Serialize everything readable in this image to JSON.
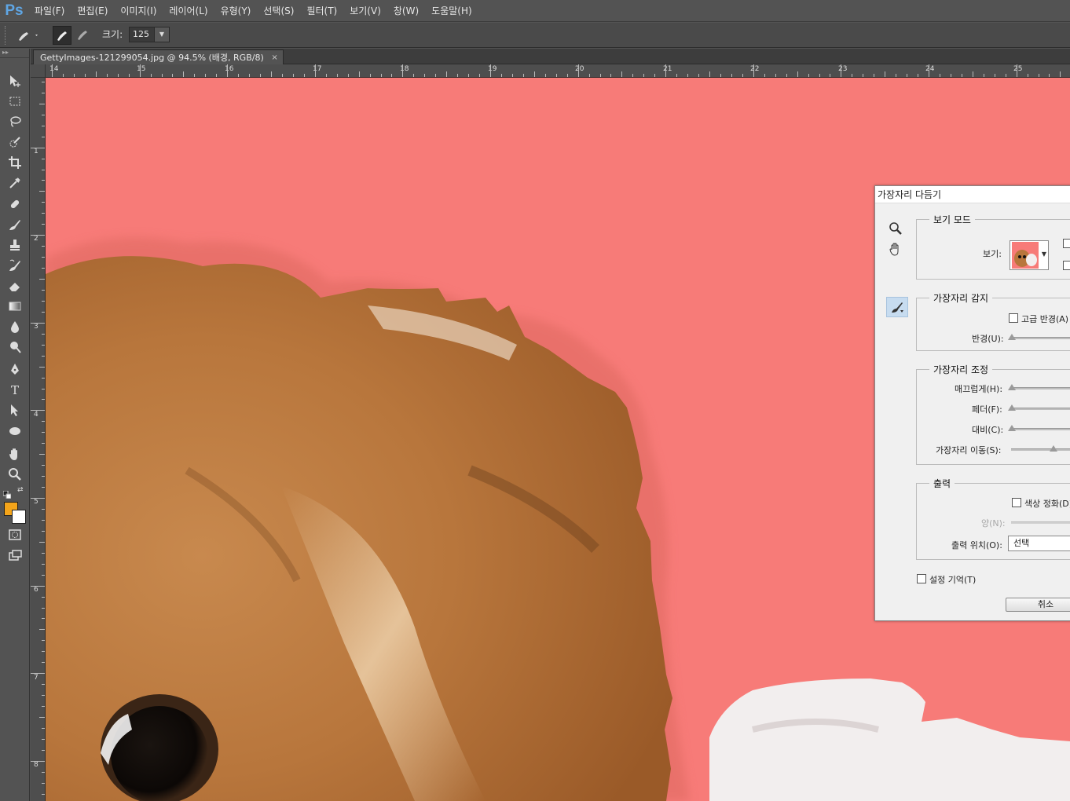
{
  "app": {
    "logo": "Ps",
    "menu": [
      "파일(F)",
      "편집(E)",
      "이미지(I)",
      "레이어(L)",
      "유형(Y)",
      "선택(S)",
      "필터(T)",
      "보기(V)",
      "창(W)",
      "도움말(H)"
    ]
  },
  "options_bar": {
    "size_label": "크기:",
    "size_value": "125"
  },
  "document": {
    "tab_title": "GettyImages-121299054.jpg @ 94.5% (배경, RGB/8)",
    "close_glyph": "×"
  },
  "rulers": {
    "horizontal": [
      "14",
      "15",
      "16",
      "17",
      "18",
      "19",
      "20",
      "21",
      "22",
      "23",
      "24",
      "25"
    ],
    "vertical": [
      "1",
      "2",
      "3",
      "4",
      "5",
      "6",
      "7",
      "8"
    ]
  },
  "colors": {
    "foreground": "#f5a51a",
    "background": "#ffffff",
    "overlay": "#f77b78"
  },
  "dialog": {
    "title": "가장자리 다듬기",
    "view_mode": {
      "title": "보기 모드",
      "view_label": "보기:"
    },
    "edge_detection": {
      "title": "가장자리 감지",
      "smart_radius": "고급 반경(A)",
      "radius": "반경(U):"
    },
    "adjust_edge": {
      "title": "가장자리 조정",
      "smooth": "매끄럽게(H):",
      "feather": "페더(F):",
      "contrast": "대비(C):",
      "shift_edge": "가장자리 이동(S):"
    },
    "output": {
      "title": "출력",
      "decontaminate": "색상 정화(D)",
      "amount": "양(N):",
      "output_to_label": "출력 위치(O):",
      "output_to_value": "선택"
    },
    "remember_settings": "설정 기억(T)",
    "cancel_button": "취소"
  },
  "icons": {
    "tools": [
      "move-icon",
      "marquee-icon",
      "lasso-icon",
      "quick-selection-icon",
      "crop-icon",
      "eyedropper-icon",
      "healing-brush-icon",
      "brush-icon",
      "clone-stamp-icon",
      "history-brush-icon",
      "eraser-icon",
      "gradient-icon",
      "blur-icon",
      "dodge-icon",
      "pen-icon",
      "type-icon",
      "path-selection-icon",
      "ellipse-icon",
      "hand-icon",
      "zoom-icon"
    ],
    "dialog_tools": [
      "zoom-icon",
      "hand-icon",
      "refine-radius-brush-icon"
    ]
  }
}
